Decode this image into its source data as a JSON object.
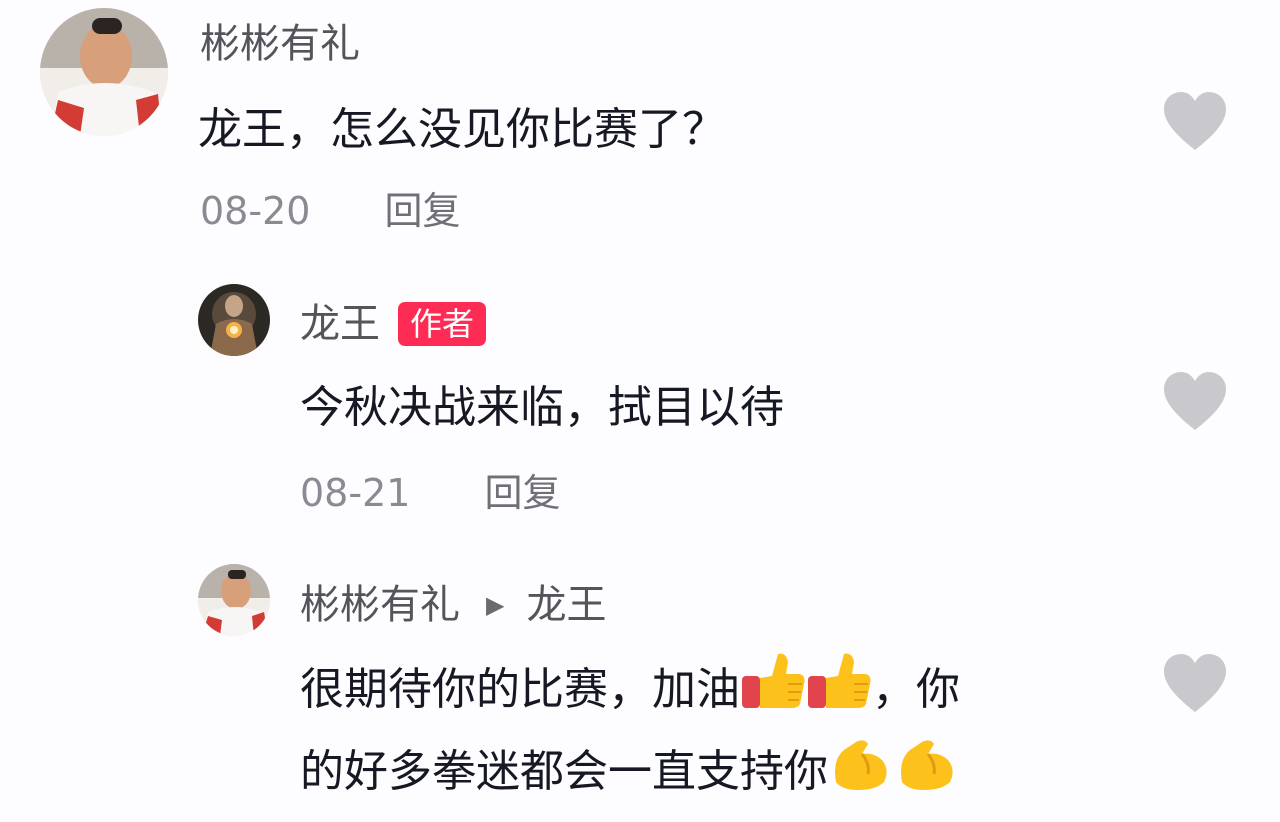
{
  "comments": [
    {
      "username": "彬彬有礼",
      "text": "龙王，怎么没见你比赛了？",
      "date": "08-20",
      "reply_label": "回复"
    },
    {
      "username": "龙王",
      "badge": "作者",
      "text": "今秋决战来临，拭目以待",
      "date": "08-21",
      "reply_label": "回复"
    },
    {
      "username": "彬彬有礼",
      "reply_to": "龙王",
      "text_line1": "很期待你的比赛，加油",
      "text_line1_tail": "，你",
      "text_line2": "的好多拳迷都会一直支持你"
    }
  ],
  "icons": {
    "like": "heart-icon",
    "reply_arrow": "triangle-right-icon",
    "emoji_thumbs": "thumbs-up-emoji",
    "emoji_muscle": "flexed-biceps-emoji"
  },
  "colors": {
    "author_badge": "#fe2c55",
    "heart": "#c9c8cc",
    "meta_text": "#8a8a93"
  }
}
